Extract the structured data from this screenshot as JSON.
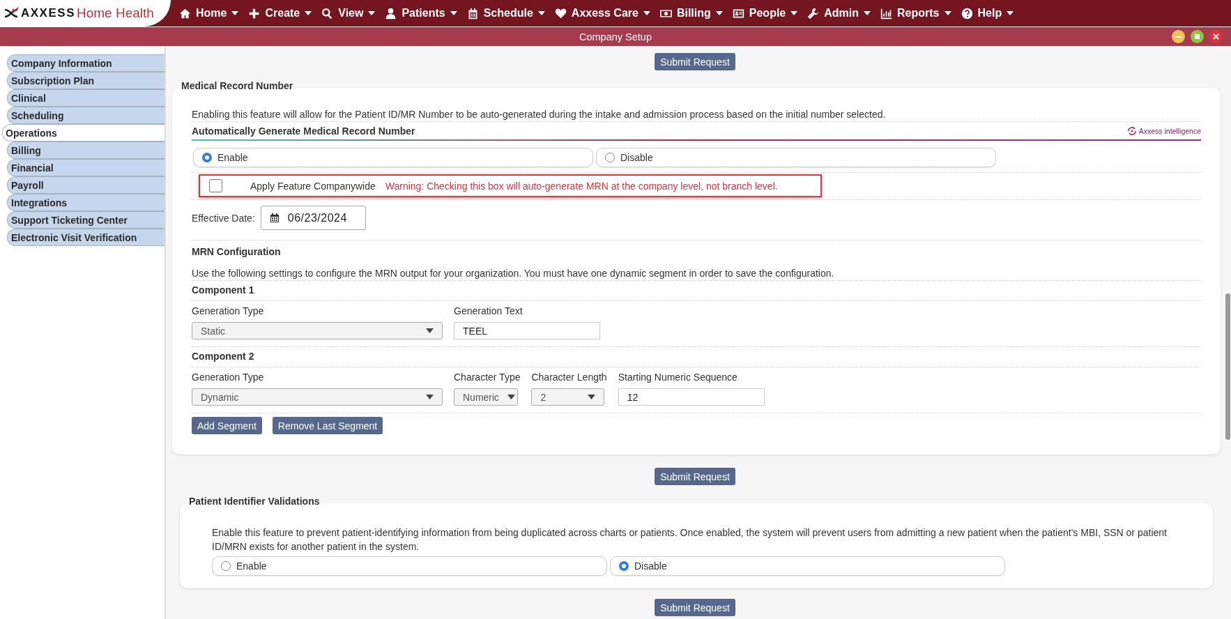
{
  "brand": {
    "name_bold": "AXXESS",
    "name_light": "Home Health"
  },
  "nav": [
    {
      "label": "Home"
    },
    {
      "label": "Create"
    },
    {
      "label": "View"
    },
    {
      "label": "Patients"
    },
    {
      "label": "Schedule"
    },
    {
      "label": "Axxess Care"
    },
    {
      "label": "Billing"
    },
    {
      "label": "People"
    },
    {
      "label": "Admin"
    },
    {
      "label": "Reports"
    },
    {
      "label": "Help"
    }
  ],
  "window": {
    "title": "Company Setup",
    "controls": [
      {
        "kind": "minimize",
        "color": "#f0c24f"
      },
      {
        "kind": "maximize",
        "color": "#8cc63f"
      },
      {
        "kind": "close",
        "color": "#e0303a"
      }
    ]
  },
  "sidebar": {
    "items": [
      {
        "label": "Company Information",
        "selected": false
      },
      {
        "label": "Subscription Plan",
        "selected": false
      },
      {
        "label": "Clinical",
        "selected": false
      },
      {
        "label": "Scheduling",
        "selected": false
      },
      {
        "label": "Operations",
        "selected": true
      },
      {
        "label": "Billing",
        "selected": false
      },
      {
        "label": "Financial",
        "selected": false
      },
      {
        "label": "Payroll",
        "selected": false
      },
      {
        "label": "Integrations",
        "selected": false
      },
      {
        "label": "Support Ticketing Center",
        "selected": false
      },
      {
        "label": "Electronic Visit Verification",
        "selected": false
      }
    ]
  },
  "top_submit": "Submit Request",
  "mrn_section": {
    "legend": "Medical Record Number",
    "description": "Enabling this feature will allow for the Patient ID/MR Number to be auto-generated during the intake and admission process based on the initial number selected.",
    "feature_title": "Automatically Generate Medical Record Number",
    "ai_badge": "Axxess intelligence",
    "options": [
      {
        "label": "Enable",
        "selected": true
      },
      {
        "label": "Disable",
        "selected": false
      }
    ],
    "companywide": {
      "label": "Apply Feature Companywide",
      "checked": false,
      "warning": "Warning: Checking this box will auto-generate MRN at the company level, not branch level."
    },
    "effective_date": {
      "label": "Effective Date:",
      "value": "06/23/2024"
    },
    "config": {
      "title": "MRN Configuration",
      "description": "Use the following settings to configure the MRN output for your organization. You must have one dynamic segment in order to save the configuration.",
      "components": [
        {
          "title": "Component 1",
          "fields": [
            {
              "kind": "select",
              "label": "Generation Type",
              "value": "Static"
            },
            {
              "kind": "text",
              "label": "Generation Text",
              "value": "TEEL"
            }
          ]
        },
        {
          "title": "Component 2",
          "fields": [
            {
              "kind": "select",
              "label": "Generation Type",
              "value": "Dynamic"
            },
            {
              "kind": "select",
              "label": "Character Type",
              "value": "Numeric"
            },
            {
              "kind": "select",
              "label": "Character Length",
              "value": "2"
            },
            {
              "kind": "text",
              "label": "Starting Numeric Sequence",
              "value": "12"
            }
          ]
        }
      ]
    },
    "buttons": [
      "Add Segment",
      "Remove Last Segment"
    ]
  },
  "middle_submit": "Submit Request",
  "patient_identifier_section": {
    "legend": "Patient Identifier Validations",
    "description": "Enable this feature to prevent patient-identifying information from being duplicated across charts or patients. Once enabled, the system will prevent users from admitting a new patient when the patient's MBI, SSN or patient ID/MRN exists for another patient in the system.",
    "options": [
      {
        "label": "Enable",
        "selected": false
      },
      {
        "label": "Disable",
        "selected": true
      }
    ]
  },
  "bottom_submit": "Submit Request"
}
